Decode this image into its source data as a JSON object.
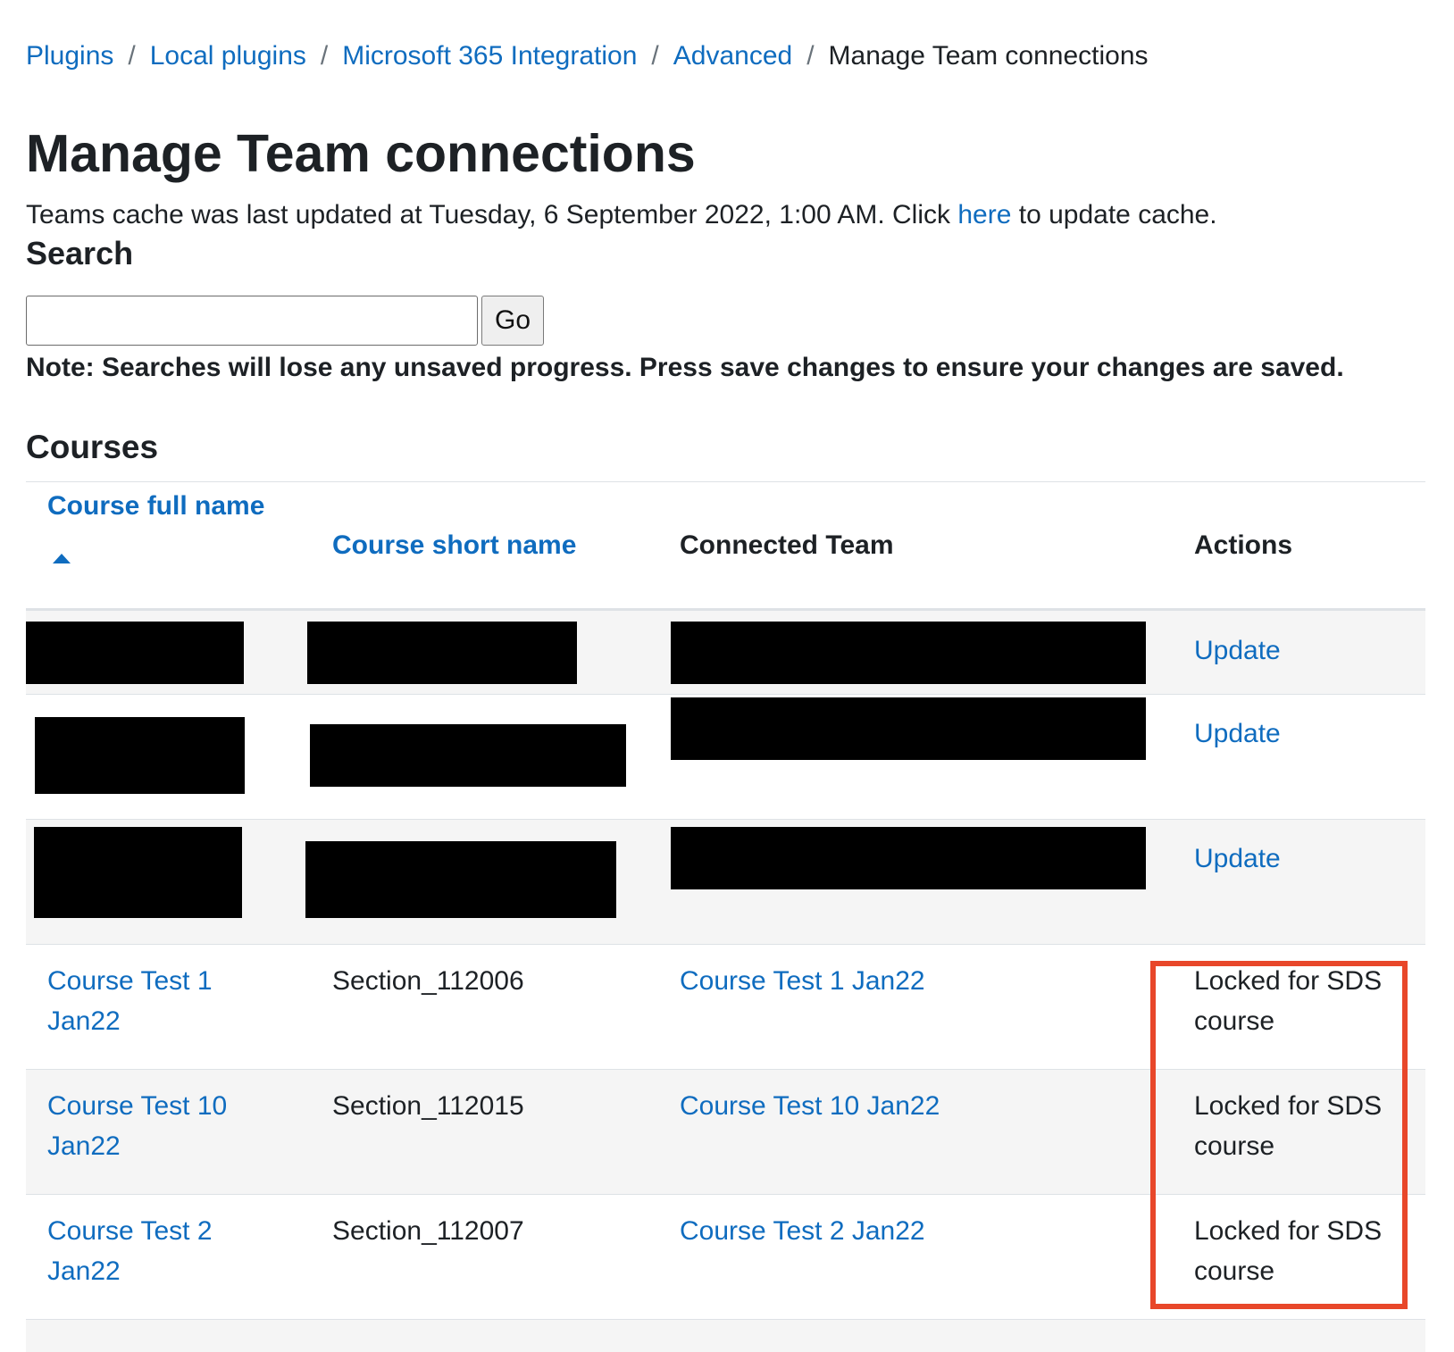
{
  "breadcrumb": {
    "items": [
      "Plugins",
      "Local plugins",
      "Microsoft 365 Integration",
      "Advanced"
    ],
    "current": "Manage Team connections",
    "separator": "/"
  },
  "page_title": "Manage Team connections",
  "cache": {
    "prefix": "Teams cache was last updated at Tuesday, 6 September 2022, 1:00 AM. Click ",
    "link_label": "here",
    "suffix": " to update cache."
  },
  "search": {
    "heading": "Search",
    "value": "",
    "button_label": "Go"
  },
  "note": "Note: Searches will lose any unsaved progress. Press save changes to ensure your changes are saved.",
  "courses": {
    "heading": "Courses",
    "columns": {
      "full_name": "Course full name",
      "short_name": "Course short name",
      "connected_team": "Connected Team",
      "actions": "Actions"
    },
    "sort": {
      "column": "full_name",
      "direction": "ascending"
    },
    "redacted_rows": [
      {
        "action": "Update"
      },
      {
        "action": "Update"
      },
      {
        "action": "Update"
      }
    ],
    "rows": [
      {
        "full_name_line1": "Course Test 1",
        "full_name_line2": "Jan22",
        "short_name": "Section_112006",
        "team": "Course Test 1 Jan22",
        "action_line1": "Locked for SDS",
        "action_line2": "course"
      },
      {
        "full_name_line1": "Course Test 10",
        "full_name_line2": "Jan22",
        "short_name": "Section_112015",
        "team": "Course Test 10 Jan22",
        "action_line1": "Locked for SDS",
        "action_line2": "course"
      },
      {
        "full_name_line1": "Course Test 2",
        "full_name_line2": "Jan22",
        "short_name": "Section_112007",
        "team": "Course Test 2 Jan22",
        "action_line1": "Locked for SDS",
        "action_line2": "course"
      }
    ]
  },
  "colors": {
    "link": "#0f6cbf",
    "text": "#1d2125",
    "stripe": "#f5f5f5",
    "highlight": "#e8472a"
  }
}
